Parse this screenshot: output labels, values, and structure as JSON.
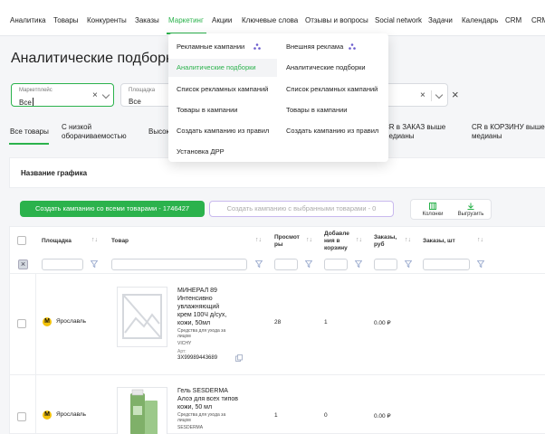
{
  "nav": {
    "items": [
      "Аналитика",
      "Товары",
      "Конкуренты",
      "Заказы",
      "Маркетинг",
      "Акции",
      "Ключевые слова",
      "Отзывы и вопросы",
      "Social network",
      "Задачи",
      "Календарь",
      "CRM",
      "CRM"
    ],
    "active": "Маркетинг"
  },
  "page": {
    "title": "Аналитические подборки"
  },
  "filters": {
    "marketplace": {
      "label": "Маркетплейс",
      "value": "Все"
    },
    "platform": {
      "label": "Площадка",
      "value": "Все"
    }
  },
  "tabs": [
    "Все товары",
    "С низкой\nоборачиваемостью",
    "Высок",
    "CR в ЗАКАЗ выше\nмедианы",
    "CR в КОРЗИНУ выше\nмедианы"
  ],
  "chart_name_label": "Название графика",
  "actions": {
    "create_all": "Создать кампанию со всеми товарами - 1746427",
    "create_selected": "Создать кампанию с выбранными товарами - 0",
    "columns": "Колонки",
    "export": "Выгрузить"
  },
  "table": {
    "headers": {
      "platform": "Площадка",
      "product": "Товар",
      "views": "Просмот\nры",
      "cart": "Добавле\nния в\nкорзину",
      "orders_rub": "Заказы,\nруб",
      "orders_qty": "Заказы, шт"
    },
    "rows": [
      {
        "platform": "Ярославль",
        "name": "МИНЕРАЛ 89\nИнтенсивно\nувлажняющий\nкрем 100Ч д/сух,\nкожи, 50мл",
        "category": "Средства для ухода за\nлицом",
        "brand": "VICHY",
        "art_label": "Арт:",
        "art": "3Х99989443689",
        "views": "28",
        "cart": "1",
        "orders_rub": "0.00 ₽"
      },
      {
        "platform": "Ярославль",
        "name": "Гель SESDERMA\nАлоэ для всех типов\nкожи, 50 мл",
        "category": "Средства для ухода за\nлицом",
        "brand": "SESDERMA",
        "views": "1",
        "cart": "0",
        "orders_rub": "0.00 ₽"
      }
    ]
  },
  "dropdown": {
    "col1": [
      "Рекламные кампании",
      "Аналитические подборки",
      "Список рекламных кампаний",
      "Товары в кампании",
      "Создать кампанию из правил",
      "Установка ДРР"
    ],
    "col2": [
      "Внешняя реклама",
      "Аналитические подборки",
      "Список рекламных кампаний",
      "Товары в кампании",
      "Создать кампанию из правил"
    ],
    "highlighted": "Аналитические подборки"
  },
  "colors": {
    "accent": "#2bb24c",
    "purple_icon": "#6a5acd",
    "yandex": "#f3c20b"
  }
}
